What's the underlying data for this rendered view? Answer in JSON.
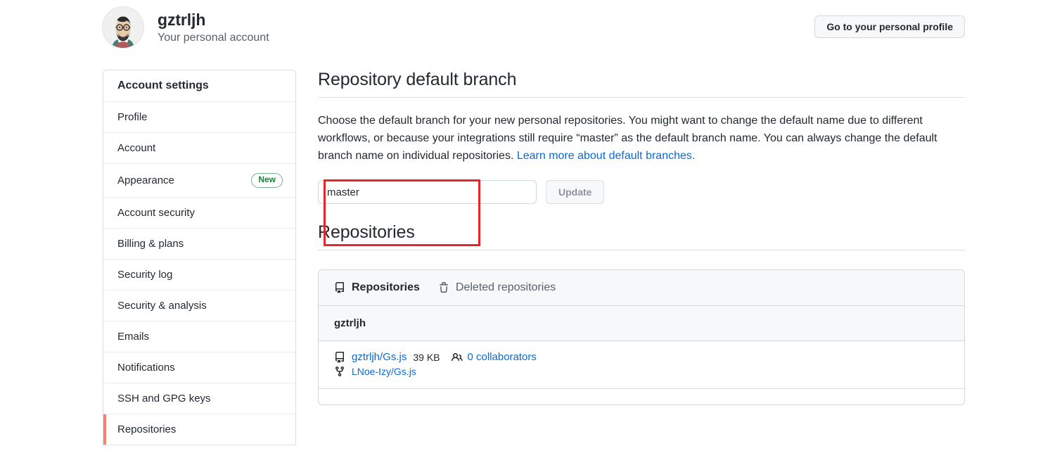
{
  "header": {
    "username": "gztrljh",
    "subtitle": "Your personal account",
    "avatar_icon": "user-illustration-avatar",
    "profile_button": "Go to your personal profile"
  },
  "sidebar": {
    "title": "Account settings",
    "items": [
      {
        "label": "Profile",
        "active": false,
        "badge": ""
      },
      {
        "label": "Account",
        "active": false,
        "badge": ""
      },
      {
        "label": "Appearance",
        "active": false,
        "badge": "New"
      },
      {
        "label": "Account security",
        "active": false,
        "badge": ""
      },
      {
        "label": "Billing & plans",
        "active": false,
        "badge": ""
      },
      {
        "label": "Security log",
        "active": false,
        "badge": ""
      },
      {
        "label": "Security & analysis",
        "active": false,
        "badge": ""
      },
      {
        "label": "Emails",
        "active": false,
        "badge": ""
      },
      {
        "label": "Notifications",
        "active": false,
        "badge": ""
      },
      {
        "label": "SSH and GPG keys",
        "active": false,
        "badge": ""
      },
      {
        "label": "Repositories",
        "active": true,
        "badge": ""
      }
    ]
  },
  "main": {
    "heading": "Repository default branch",
    "description_part1": "Choose the default branch for your new personal repositories. You might want to change the default name due to different workflows, or because your integrations still require “master” as the default branch name. You can always change the default branch name on individual repositories. ",
    "description_link": "Learn more about default branches.",
    "branch_input_value": "master",
    "branch_input_placeholder": "main",
    "update_button": "Update",
    "repositories_heading": "Repositories"
  },
  "repo_card": {
    "tabs": [
      {
        "label": "Repositories",
        "icon": "repo-icon",
        "active": true
      },
      {
        "label": "Deleted repositories",
        "icon": "trash-icon",
        "active": false
      }
    ],
    "owner": "gztrljh",
    "rows": [
      {
        "name": "gztrljh/Gs.js",
        "size": "39 KB",
        "collaborators": "0 collaborators",
        "fork_parent": "LNoe-Izy/Gs.js",
        "repo_icon": "repo-icon",
        "people_icon": "people-icon",
        "fork_icon": "repo-forked-icon"
      }
    ]
  },
  "annotation": {
    "color": "#e8262a",
    "target": "branch-name-input"
  },
  "colors": {
    "link": "#0969da",
    "active_indicator": "#f9826c",
    "badge_green": "#1a7f37",
    "annotation_red": "#e8262a"
  }
}
